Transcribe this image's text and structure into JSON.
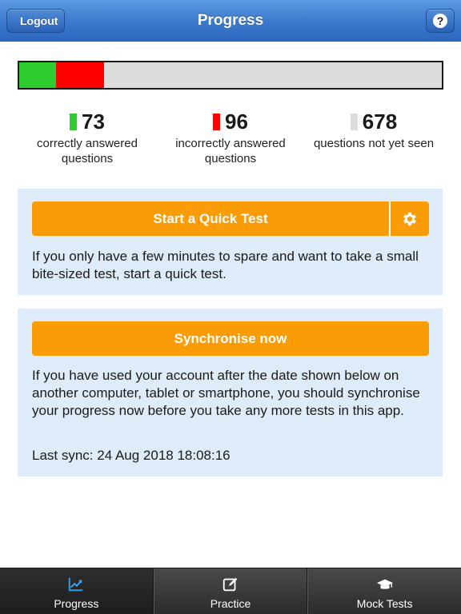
{
  "header": {
    "title": "Progress",
    "back_label": "Logout",
    "help_label": "?"
  },
  "progress": {
    "correct": 73,
    "incorrect": 96,
    "unseen": 678,
    "colors": {
      "correct": "#2ecc2e",
      "incorrect": "#ff0000",
      "unseen": "#dcdcdc"
    }
  },
  "stats": [
    {
      "value": "73",
      "label_line1": "correctly answered",
      "label_line2": "questions",
      "color": "#2ecc2e"
    },
    {
      "value": "96",
      "label_line1": "incorrectly answered",
      "label_line2": "questions",
      "color": "#ff0000"
    },
    {
      "value": "678",
      "label_line1": "questions not yet seen",
      "label_line2": "",
      "color": "#dcdcdc"
    }
  ],
  "quick_test": {
    "button_label": "Start a Quick Test",
    "settings_icon": "gear-icon",
    "description": "If you only have a few minutes to spare and want to take a small bite-sized test, start a quick test."
  },
  "sync": {
    "button_label": "Synchronise now",
    "description": "If you have used your account after the date shown below on another computer, tablet or smartphone, you should synchronise your progress now before you take any more tests in this app.",
    "last_sync": "Last sync: 24 Aug 2018 18:08:16"
  },
  "tabs": [
    {
      "label": "Progress",
      "icon": "chart-icon",
      "active": true
    },
    {
      "label": "Practice",
      "icon": "edit-icon",
      "active": false
    },
    {
      "label": "Mock Tests",
      "icon": "graduation-cap-icon",
      "active": false
    }
  ],
  "colors": {
    "accent_orange": "#f99c06",
    "panel_bg": "#deecf9",
    "nav_blue": "#3a78cc",
    "tab_active_icon": "#3aa0e8"
  }
}
